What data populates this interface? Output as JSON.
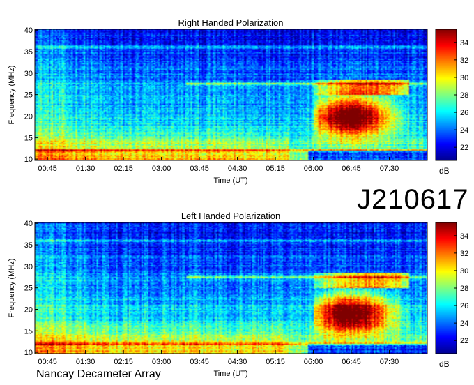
{
  "observation_id": "J210617",
  "footer": "Nancay Decameter Array",
  "colorbar": {
    "unit": "dB",
    "ticks": [
      22,
      24,
      26,
      28,
      30,
      32,
      34
    ],
    "range": [
      20.5,
      35.5
    ]
  },
  "chart_data": [
    {
      "type": "heatmap",
      "title": "Right Handed Polarization",
      "xlabel": "Time (UT)",
      "ylabel": "Frequency (MHz)",
      "x_ticks": [
        "00:45",
        "01:30",
        "02:15",
        "03:00",
        "03:45",
        "04:30",
        "05:15",
        "06:00",
        "06:45",
        "07:30"
      ],
      "y_ticks": [
        10,
        15,
        20,
        25,
        30,
        35,
        40
      ],
      "ylim": [
        9.7,
        40.2
      ],
      "xlim_hours": [
        0.5,
        8.25
      ],
      "intensity_unit": "dB",
      "colorbar_ticks": [
        22,
        24,
        26,
        28,
        30,
        32,
        34
      ],
      "features": {
        "burst_band_mhz": [
          15,
          25
        ],
        "burst_time_hours": [
          6.0,
          7.9
        ],
        "persistent_lines_mhz": [
          36,
          27.5,
          12
        ]
      }
    },
    {
      "type": "heatmap",
      "title": "Left Handed Polarization",
      "xlabel": "Time (UT)",
      "ylabel": "Frequency (MHz)",
      "x_ticks": [
        "00:45",
        "01:30",
        "02:15",
        "03:00",
        "03:45",
        "04:30",
        "05:15",
        "06:00",
        "06:45",
        "07:30"
      ],
      "y_ticks": [
        10,
        15,
        20,
        25,
        30,
        35,
        40
      ],
      "ylim": [
        9.7,
        40.2
      ],
      "xlim_hours": [
        0.5,
        8.25
      ],
      "intensity_unit": "dB",
      "colorbar_ticks": [
        22,
        24,
        26,
        28,
        30,
        32,
        34
      ],
      "features": {
        "burst_band_mhz": [
          14,
          24
        ],
        "burst_time_hours": [
          6.0,
          7.9
        ],
        "persistent_lines_mhz": [
          36,
          27.5,
          12
        ]
      }
    }
  ]
}
